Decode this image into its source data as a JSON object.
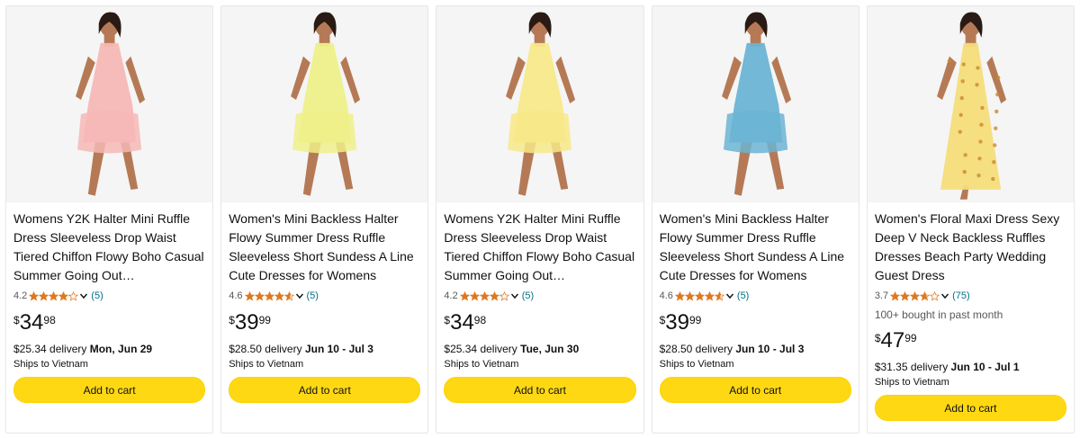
{
  "accent": "#ffd814",
  "star_color": "#de7921",
  "link_color": "#007185",
  "products": [
    {
      "dress_color": "#f6b8b6",
      "title": "Womens Y2K Halter Mini Ruffle Dress Sleeveless Drop Waist Tiered Chiffon Flowy Boho Casual Summer Going Out…",
      "rating": "4.2",
      "stars": 4.2,
      "review_count": "(5)",
      "bought": "",
      "price_symbol": "$",
      "price_whole": "34",
      "price_fraction": "98",
      "delivery_fee": "$25.34 delivery ",
      "delivery_date": "Mon, Jun 29",
      "ships": "Ships to Vietnam",
      "button": "Add to cart"
    },
    {
      "dress_color": "#eef08a",
      "title": "Women's Mini Backless Halter Flowy Summer Dress Ruffle Sleeveless Short Sundess A Line Cute Dresses for Womens",
      "rating": "4.6",
      "stars": 4.6,
      "review_count": "(5)",
      "bought": "",
      "price_symbol": "$",
      "price_whole": "39",
      "price_fraction": "99",
      "delivery_fee": "$28.50 delivery ",
      "delivery_date": "Jun 10 - Jul 3",
      "ships": "Ships to Vietnam",
      "button": "Add to cart"
    },
    {
      "dress_color": "#f7e98a",
      "title": "Womens Y2K Halter Mini Ruffle Dress Sleeveless Drop Waist Tiered Chiffon Flowy Boho Casual Summer Going Out…",
      "rating": "4.2",
      "stars": 4.2,
      "review_count": "(5)",
      "bought": "",
      "price_symbol": "$",
      "price_whole": "34",
      "price_fraction": "98",
      "delivery_fee": "$25.34 delivery ",
      "delivery_date": "Tue, Jun 30",
      "ships": "Ships to Vietnam",
      "button": "Add to cart"
    },
    {
      "dress_color": "#6bb4d4",
      "title": "Women's Mini Backless Halter Flowy Summer Dress Ruffle Sleeveless Short Sundess A Line Cute Dresses for Womens",
      "rating": "4.6",
      "stars": 4.6,
      "review_count": "(5)",
      "bought": "",
      "price_symbol": "$",
      "price_whole": "39",
      "price_fraction": "99",
      "delivery_fee": "$28.50 delivery ",
      "delivery_date": "Jun 10 - Jul 3",
      "ships": "Ships to Vietnam",
      "button": "Add to cart"
    },
    {
      "dress_color": "#f4dd7a",
      "title": "Women's Floral Maxi Dress Sexy Deep V Neck Backless Ruffles Dresses Beach Party Wedding Guest Dress",
      "rating": "3.7",
      "stars": 3.7,
      "review_count": "(75)",
      "bought": "100+ bought in past month",
      "price_symbol": "$",
      "price_whole": "47",
      "price_fraction": "99",
      "delivery_fee": "$31.35 delivery ",
      "delivery_date": "Jun 10 - Jul 1",
      "ships": "Ships to Vietnam",
      "button": "Add to cart"
    }
  ]
}
